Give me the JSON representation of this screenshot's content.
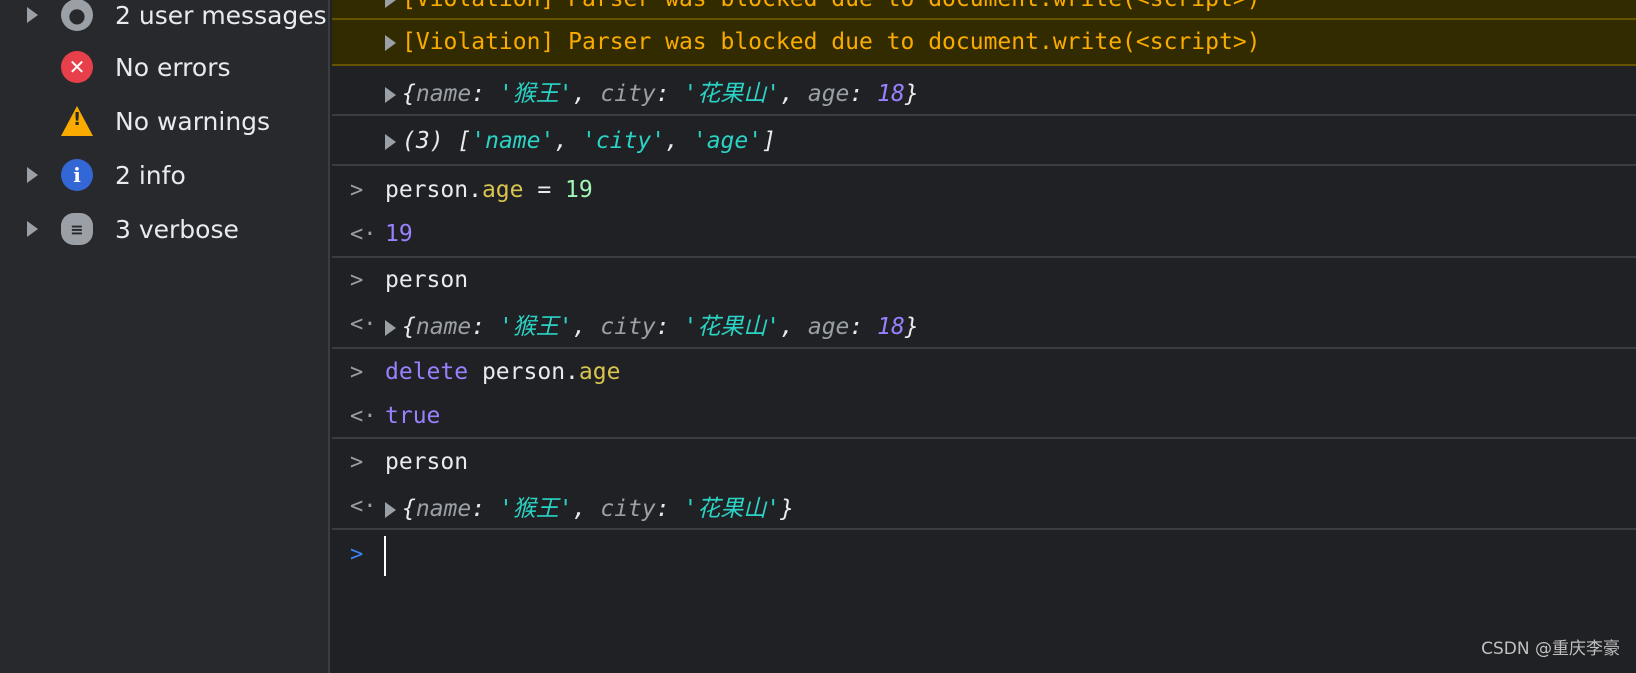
{
  "sidebar": {
    "items": [
      {
        "label": "2 user messages",
        "icon": "user-icon",
        "expandable": true
      },
      {
        "label": "No errors",
        "icon": "error-icon",
        "expandable": false
      },
      {
        "label": "No warnings",
        "icon": "warning-icon",
        "expandable": false
      },
      {
        "label": "2 info",
        "icon": "info-icon",
        "expandable": true
      },
      {
        "label": "3 verbose",
        "icon": "bug-icon",
        "expandable": true
      }
    ]
  },
  "console": {
    "violations": [
      "[Violation] Parser was blocked due to document.write(<script>)",
      "[Violation] Parser was blocked due to document.write(<script>)"
    ],
    "obj_full": {
      "open": "{",
      "k1": "name",
      "v1": "'猴王'",
      "k2": "city",
      "v2": "'花果山'",
      "k3": "age",
      "v3": "18",
      "close": "}"
    },
    "array": {
      "count": "(3)",
      "items": [
        "'name'",
        "'city'",
        "'age'"
      ]
    },
    "cmd1": {
      "obj": "person",
      "prop": "age",
      "op": " = ",
      "val": "19"
    },
    "res1": "19",
    "cmd2": "person",
    "cmd3": {
      "kw": "delete",
      "obj": "person",
      "prop": "age"
    },
    "res3": "true",
    "cmd4": "person"
  },
  "colors": {
    "background": "#202124",
    "violation_text": "#f9ab00",
    "string": "#2ad3c5",
    "number": "#9980ff"
  },
  "watermark": "CSDN @重庆李豪"
}
